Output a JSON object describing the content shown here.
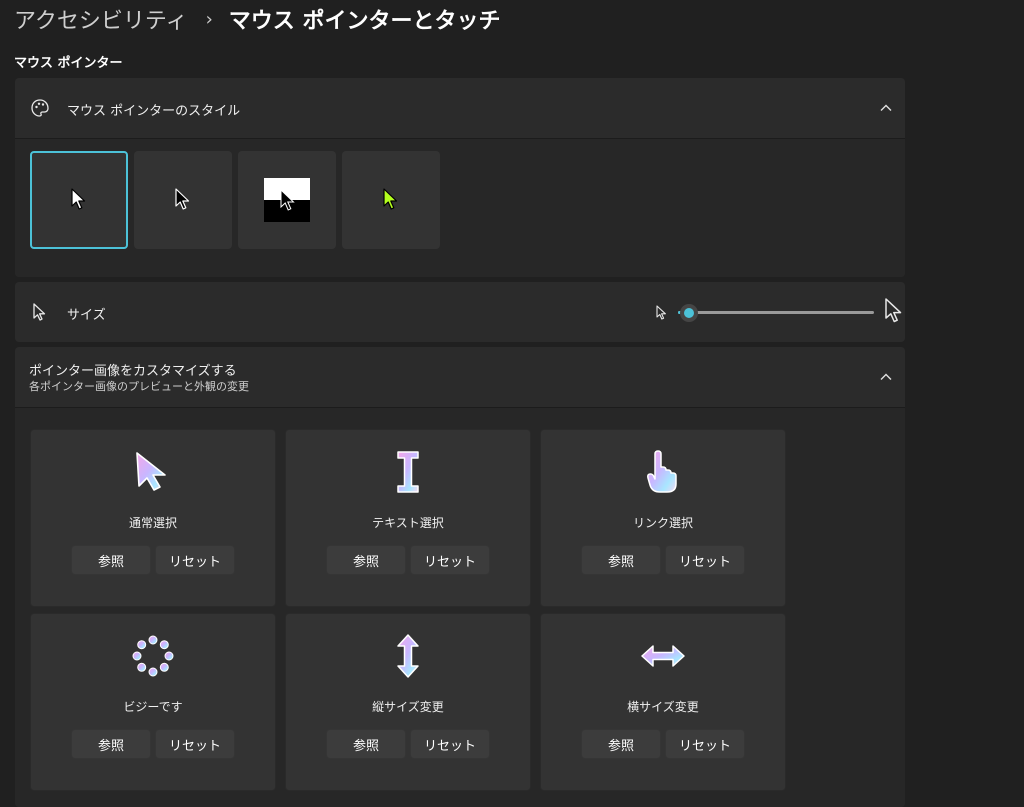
{
  "breadcrumb": {
    "parent": "アクセシビリティ",
    "separator": "›",
    "current": "マウス ポインターとタッチ"
  },
  "section": {
    "heading": "マウス ポインター"
  },
  "pointer_style": {
    "label": "マウス ポインターのスタイル",
    "icon": "palette-icon",
    "expanded": true,
    "options": [
      {
        "name": "white",
        "selected": true
      },
      {
        "name": "black",
        "selected": false
      },
      {
        "name": "inverted",
        "selected": false
      },
      {
        "name": "custom",
        "selected": false,
        "color": "#b4ff1e"
      }
    ]
  },
  "size": {
    "label": "サイズ",
    "icon": "pointer-icon",
    "value": 1,
    "min": 1,
    "max": 15
  },
  "customize": {
    "title": "ポインター画像をカスタマイズする",
    "subtitle": "各ポインター画像のプレビューと外観の変更",
    "expanded": true,
    "browse_label": "参照",
    "reset_label": "リセット",
    "tiles": [
      {
        "label": "通常選択",
        "icon": "arrow-pointer-icon"
      },
      {
        "label": "テキスト選択",
        "icon": "text-cursor-icon"
      },
      {
        "label": "リンク選択",
        "icon": "hand-pointer-icon"
      },
      {
        "label": "ビジーです",
        "icon": "busy-spinner-icon"
      },
      {
        "label": "縦サイズ変更",
        "icon": "vertical-resize-icon"
      },
      {
        "label": "横サイズ変更",
        "icon": "horizontal-resize-icon"
      }
    ]
  },
  "colors": {
    "accent": "#4cc2d8",
    "background": "#202020",
    "card": "#2b2b2b",
    "tile": "#333333"
  }
}
